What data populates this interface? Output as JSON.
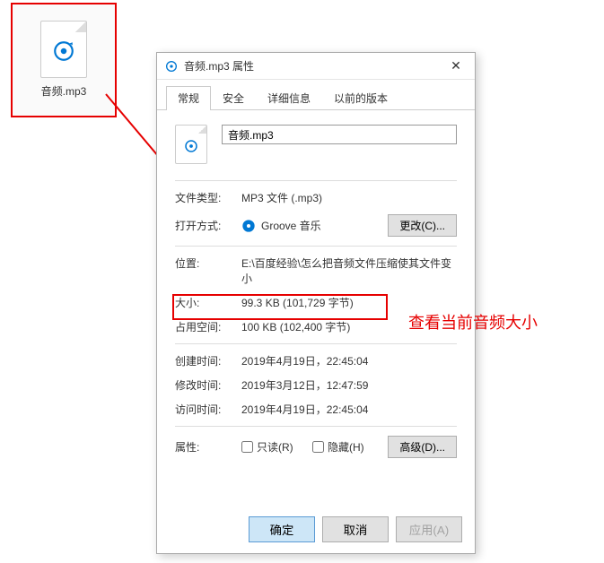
{
  "desktop": {
    "file_name": "音频.mp3"
  },
  "dialog": {
    "title": "音频.mp3 属性",
    "tabs": [
      "常规",
      "安全",
      "详细信息",
      "以前的版本"
    ],
    "filename_value": "音频.mp3",
    "rows": {
      "file_type_label": "文件类型:",
      "file_type_value": "MP3 文件 (.mp3)",
      "open_with_label": "打开方式:",
      "open_with_value": "Groove 音乐",
      "change_btn": "更改(C)...",
      "location_label": "位置:",
      "location_value": "E:\\百度经验\\怎么把音频文件压缩使其文件变小",
      "size_label": "大小:",
      "size_value": "99.3 KB (101,729 字节)",
      "size_on_disk_label": "占用空间:",
      "size_on_disk_value": "100 KB (102,400 字节)",
      "created_label": "创建时间:",
      "created_value": "2019年4月19日，22:45:04",
      "modified_label": "修改时间:",
      "modified_value": "2019年3月12日，12:47:59",
      "accessed_label": "访问时间:",
      "accessed_value": "2019年4月19日，22:45:04",
      "attrs_label": "属性:",
      "readonly_label": "只读(R)",
      "hidden_label": "隐藏(H)",
      "advanced_btn": "高级(D)..."
    },
    "buttons": {
      "ok": "确定",
      "cancel": "取消",
      "apply": "应用(A)"
    }
  },
  "annotation_text": "查看当前音频大小"
}
